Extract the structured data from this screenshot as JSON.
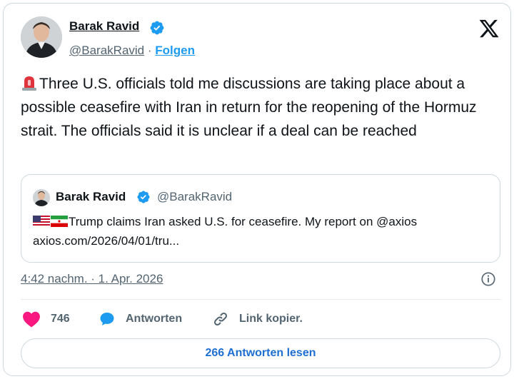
{
  "author": {
    "name": "Barak Ravid",
    "handle": "@BarakRavid",
    "separator": "·",
    "follow_label": "Folgen"
  },
  "tweet": {
    "text": "Three U.S. officials told me discussions are taking place about a possible ceasefire with Iran in return for the reopening of the Hormuz strait. The officials said it is unclear if a deal can be reached"
  },
  "quoted_tweet": {
    "name": "Barak Ravid",
    "handle": "@BarakRavid",
    "line1": "Trump claims Iran asked U.S. for ceasefire. My report on @axios",
    "line2": "axios.com/2026/04/01/tru..."
  },
  "timestamp": "4:42 nachm. · 1. Apr. 2026",
  "actions": {
    "like_count": "746",
    "reply_label": "Antworten",
    "copy_label": "Link kopier."
  },
  "read_replies_label": "266 Antworten lesen",
  "colors": {
    "accent": "#1d9bf0",
    "like": "#f91880",
    "muted": "#536471",
    "border": "#cfd9de"
  },
  "icons": [
    "verified-badge-icon",
    "x-logo-icon",
    "siren-icon",
    "us-flag-icon",
    "iran-flag-icon",
    "info-icon",
    "heart-icon",
    "reply-bubble-icon",
    "link-icon"
  ]
}
